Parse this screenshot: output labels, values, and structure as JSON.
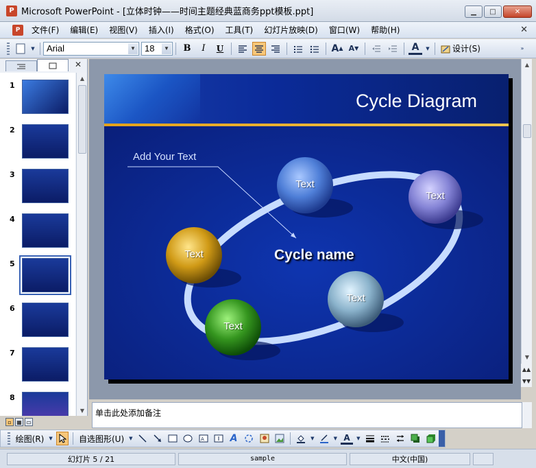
{
  "window": {
    "app_name": "Microsoft PowerPoint",
    "title": "Microsoft PowerPoint - [立体时钟——时间主题经典蓝商务ppt模板.ppt]",
    "minimize": "▁",
    "maximize": "□",
    "close": "✕"
  },
  "menu": {
    "items": [
      "文件(F)",
      "编辑(E)",
      "视图(V)",
      "插入(I)",
      "格式(O)",
      "工具(T)",
      "幻灯片放映(D)",
      "窗口(W)",
      "帮助(H)"
    ],
    "close": "✕"
  },
  "toolbar": {
    "font_name": "Arial",
    "font_size": "18",
    "bold": "B",
    "italic": "I",
    "underline": "U",
    "design": "设计(S)"
  },
  "left_pane": {
    "slide_numbers": [
      "1",
      "2",
      "3",
      "4",
      "5",
      "6",
      "7",
      "8"
    ],
    "selected_index": 4,
    "close": "✕"
  },
  "slide": {
    "title": "Cycle Diagram",
    "add_text": "Add Your Text",
    "center_label": "Cycle name",
    "balls": [
      {
        "label": "Text",
        "color": "#5b8ee6"
      },
      {
        "label": "Text",
        "color": "#8f8ee0"
      },
      {
        "label": "Text",
        "color": "#d6a21a"
      },
      {
        "label": "Text",
        "color": "#8fb7cf"
      },
      {
        "label": "Text",
        "color": "#3a9a25"
      }
    ]
  },
  "notes": {
    "placeholder": "单击此处添加备注"
  },
  "draw_toolbar": {
    "draw": "绘图(R)",
    "autoshapes": "自选图形(U)"
  },
  "status": {
    "slide_info": "幻灯片 5 / 21",
    "template": "sample",
    "language": "中文(中国)"
  }
}
